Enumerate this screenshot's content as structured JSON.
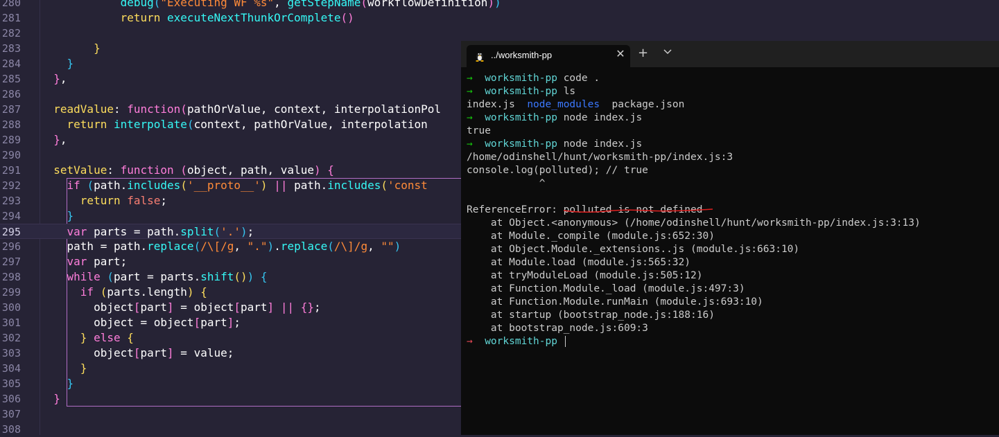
{
  "editor": {
    "lines": [
      {
        "n": "280",
        "segs": [
          {
            "t": "            "
          },
          {
            "t": "debug",
            "c": "f"
          },
          {
            "t": "(",
            "c": "b3"
          },
          {
            "t": "\"Executing WF %s\"",
            "c": "s"
          },
          {
            "t": ", "
          },
          {
            "t": "getStepName",
            "c": "f"
          },
          {
            "t": "(",
            "c": "b2"
          },
          {
            "t": "workflowDefinition",
            "c": "w"
          },
          {
            "t": ")",
            "c": "b2"
          },
          {
            "t": ")",
            "c": "b3"
          }
        ]
      },
      {
        "n": "281",
        "segs": [
          {
            "t": "            "
          },
          {
            "t": "return ",
            "c": "k"
          },
          {
            "t": "executeNextThunkOrComplete",
            "c": "f"
          },
          {
            "t": "()",
            "c": "b2"
          }
        ]
      },
      {
        "n": "282",
        "segs": []
      },
      {
        "n": "283",
        "segs": [
          {
            "t": "        "
          },
          {
            "t": "}",
            "c": "b1"
          }
        ]
      },
      {
        "n": "284",
        "segs": [
          {
            "t": "    "
          },
          {
            "t": "}",
            "c": "b3"
          }
        ]
      },
      {
        "n": "285",
        "segs": [
          {
            "t": "  "
          },
          {
            "t": "}",
            "c": "b2"
          },
          {
            "t": ","
          }
        ]
      },
      {
        "n": "286",
        "segs": []
      },
      {
        "n": "287",
        "segs": [
          {
            "t": "  "
          },
          {
            "t": "readValue",
            "c": "k"
          },
          {
            "t": ": "
          },
          {
            "t": "function",
            "c": "p"
          },
          {
            "t": "(",
            "c": "b2"
          },
          {
            "t": "pathOrValue, context, interpolationPol"
          }
        ]
      },
      {
        "n": "288",
        "segs": [
          {
            "t": "    "
          },
          {
            "t": "return ",
            "c": "k"
          },
          {
            "t": "interpolate",
            "c": "f"
          },
          {
            "t": "(",
            "c": "b3"
          },
          {
            "t": "context, pathOrValue, interpolation"
          }
        ]
      },
      {
        "n": "289",
        "segs": [
          {
            "t": "  "
          },
          {
            "t": "}",
            "c": "b2"
          },
          {
            "t": ","
          }
        ]
      },
      {
        "n": "290",
        "segs": []
      },
      {
        "n": "291",
        "segs": [
          {
            "t": "  "
          },
          {
            "t": "setValue",
            "c": "k"
          },
          {
            "t": ": "
          },
          {
            "t": "function ",
            "c": "p"
          },
          {
            "t": "(",
            "c": "b2"
          },
          {
            "t": "object, path, value"
          },
          {
            "t": ")",
            "c": "b2"
          },
          {
            "t": " "
          },
          {
            "t": "{",
            "c": "b2"
          }
        ]
      },
      {
        "n": "292",
        "segs": [
          {
            "t": "    "
          },
          {
            "t": "if ",
            "c": "p"
          },
          {
            "t": "(",
            "c": "b3"
          },
          {
            "t": "path."
          },
          {
            "t": "includes",
            "c": "f"
          },
          {
            "t": "(",
            "c": "b1"
          },
          {
            "t": "'__proto__'",
            "c": "s"
          },
          {
            "t": ")",
            "c": "b1"
          },
          {
            "t": " "
          },
          {
            "t": "||",
            "c": "p"
          },
          {
            "t": " path."
          },
          {
            "t": "includes",
            "c": "f"
          },
          {
            "t": "(",
            "c": "b1"
          },
          {
            "t": "'const",
            "c": "s"
          }
        ]
      },
      {
        "n": "293",
        "segs": [
          {
            "t": "      "
          },
          {
            "t": "return ",
            "c": "k"
          },
          {
            "t": "false",
            "c": "r"
          },
          {
            "t": ";"
          }
        ]
      },
      {
        "n": "294",
        "segs": [
          {
            "t": "    "
          },
          {
            "t": "}",
            "c": "b3"
          }
        ]
      },
      {
        "n": "295",
        "segs": [
          {
            "t": "    "
          },
          {
            "t": "var ",
            "c": "p"
          },
          {
            "t": "parts = path."
          },
          {
            "t": "split",
            "c": "f"
          },
          {
            "t": "(",
            "c": "b3"
          },
          {
            "t": "'.'",
            "c": "s"
          },
          {
            "t": ")",
            "c": "b3"
          },
          {
            "t": ";"
          }
        ]
      },
      {
        "n": "296",
        "segs": [
          {
            "t": "    path = path."
          },
          {
            "t": "replace",
            "c": "f"
          },
          {
            "t": "(",
            "c": "b3"
          },
          {
            "t": "/\\[/g",
            "c": "s"
          },
          {
            "t": ", "
          },
          {
            "t": "\".\"",
            "c": "s"
          },
          {
            "t": ")",
            "c": "b3"
          },
          {
            "t": "."
          },
          {
            "t": "replace",
            "c": "f"
          },
          {
            "t": "(",
            "c": "b3"
          },
          {
            "t": "/\\]/g",
            "c": "s"
          },
          {
            "t": ", "
          },
          {
            "t": "\"\"",
            "c": "s"
          },
          {
            "t": ")",
            "c": "b3"
          }
        ]
      },
      {
        "n": "297",
        "segs": [
          {
            "t": "    "
          },
          {
            "t": "var ",
            "c": "p"
          },
          {
            "t": "part;"
          }
        ]
      },
      {
        "n": "298",
        "segs": [
          {
            "t": "    "
          },
          {
            "t": "while ",
            "c": "p"
          },
          {
            "t": "(",
            "c": "b3"
          },
          {
            "t": "part = parts."
          },
          {
            "t": "shift",
            "c": "f"
          },
          {
            "t": "()",
            "c": "b1"
          },
          {
            "t": ")",
            "c": "b3"
          },
          {
            "t": " "
          },
          {
            "t": "{",
            "c": "b3"
          }
        ]
      },
      {
        "n": "299",
        "segs": [
          {
            "t": "      "
          },
          {
            "t": "if ",
            "c": "p"
          },
          {
            "t": "(",
            "c": "b1"
          },
          {
            "t": "parts.length"
          },
          {
            "t": ")",
            "c": "b1"
          },
          {
            "t": " "
          },
          {
            "t": "{",
            "c": "b1"
          }
        ]
      },
      {
        "n": "300",
        "segs": [
          {
            "t": "        object"
          },
          {
            "t": "[",
            "c": "b2"
          },
          {
            "t": "part"
          },
          {
            "t": "]",
            "c": "b2"
          },
          {
            "t": " = object"
          },
          {
            "t": "[",
            "c": "b2"
          },
          {
            "t": "part"
          },
          {
            "t": "]",
            "c": "b2"
          },
          {
            "t": " "
          },
          {
            "t": "||",
            "c": "p"
          },
          {
            "t": " "
          },
          {
            "t": "{}",
            "c": "b2"
          },
          {
            "t": ";"
          }
        ]
      },
      {
        "n": "301",
        "segs": [
          {
            "t": "        object = object"
          },
          {
            "t": "[",
            "c": "b2"
          },
          {
            "t": "part"
          },
          {
            "t": "]",
            "c": "b2"
          },
          {
            "t": ";"
          }
        ]
      },
      {
        "n": "302",
        "segs": [
          {
            "t": "      "
          },
          {
            "t": "}",
            "c": "b1"
          },
          {
            "t": " "
          },
          {
            "t": "else ",
            "c": "p"
          },
          {
            "t": "{",
            "c": "b1"
          }
        ]
      },
      {
        "n": "303",
        "segs": [
          {
            "t": "        object"
          },
          {
            "t": "[",
            "c": "b2"
          },
          {
            "t": "part"
          },
          {
            "t": "]",
            "c": "b2"
          },
          {
            "t": " = value;"
          }
        ]
      },
      {
        "n": "304",
        "segs": [
          {
            "t": "      "
          },
          {
            "t": "}",
            "c": "b1"
          }
        ]
      },
      {
        "n": "305",
        "segs": [
          {
            "t": "    "
          },
          {
            "t": "}",
            "c": "b3"
          }
        ]
      },
      {
        "n": "306",
        "segs": [
          {
            "t": "  "
          },
          {
            "t": "}",
            "c": "b2"
          }
        ]
      },
      {
        "n": "307",
        "segs": []
      },
      {
        "n": "308",
        "segs": []
      }
    ]
  },
  "terminal": {
    "tab_title": "../worksmith-pp",
    "close_glyph": "✕",
    "new_tab_glyph": "+",
    "lines": [
      {
        "segs": [
          {
            "t": "→  ",
            "c": "arrow"
          },
          {
            "t": "worksmith-pp",
            "c": "dir"
          },
          {
            "t": " code ."
          }
        ]
      },
      {
        "segs": [
          {
            "t": "→  ",
            "c": "arrow"
          },
          {
            "t": "worksmith-pp",
            "c": "dir"
          },
          {
            "t": " ls"
          }
        ]
      },
      {
        "segs": [
          {
            "t": "index.js  "
          },
          {
            "t": "node_modules",
            "c": "nm"
          },
          {
            "t": "  package.json"
          }
        ]
      },
      {
        "segs": [
          {
            "t": "→  ",
            "c": "arrow"
          },
          {
            "t": "worksmith-pp",
            "c": "dir"
          },
          {
            "t": " node index.js"
          }
        ]
      },
      {
        "segs": [
          {
            "t": "true"
          }
        ]
      },
      {
        "segs": [
          {
            "t": "→  ",
            "c": "arrow"
          },
          {
            "t": "worksmith-pp",
            "c": "dir"
          },
          {
            "t": " node index.js"
          }
        ]
      },
      {
        "segs": [
          {
            "t": "/home/odinshell/hunt/worksmith-pp/index.js:3"
          }
        ]
      },
      {
        "segs": [
          {
            "t": "console.log(polluted); // true"
          }
        ]
      },
      {
        "segs": [
          {
            "t": "            ^"
          }
        ]
      },
      {
        "segs": []
      },
      {
        "segs": [
          {
            "t": "ReferenceError: polluted is not defined"
          }
        ]
      },
      {
        "segs": [
          {
            "t": "    at Object.<anonymous> (/home/odinshell/hunt/worksmith-pp/index.js:3:13)"
          }
        ]
      },
      {
        "segs": [
          {
            "t": "    at Module._compile (module.js:652:30)"
          }
        ]
      },
      {
        "segs": [
          {
            "t": "    at Object.Module._extensions..js (module.js:663:10)"
          }
        ]
      },
      {
        "segs": [
          {
            "t": "    at Module.load (module.js:565:32)"
          }
        ]
      },
      {
        "segs": [
          {
            "t": "    at tryModuleLoad (module.js:505:12)"
          }
        ]
      },
      {
        "segs": [
          {
            "t": "    at Function.Module._load (module.js:497:3)"
          }
        ]
      },
      {
        "segs": [
          {
            "t": "    at Function.Module.runMain (module.js:693:10)"
          }
        ]
      },
      {
        "segs": [
          {
            "t": "    at startup (bootstrap_node.js:188:16)"
          }
        ]
      },
      {
        "segs": [
          {
            "t": "    at bootstrap_node.js:609:3"
          }
        ]
      },
      {
        "segs": [
          {
            "t": "→  ",
            "c": "arrow err"
          },
          {
            "t": "worksmith-pp",
            "c": "dir"
          },
          {
            "t": " "
          }
        ],
        "cursor": true
      }
    ]
  }
}
